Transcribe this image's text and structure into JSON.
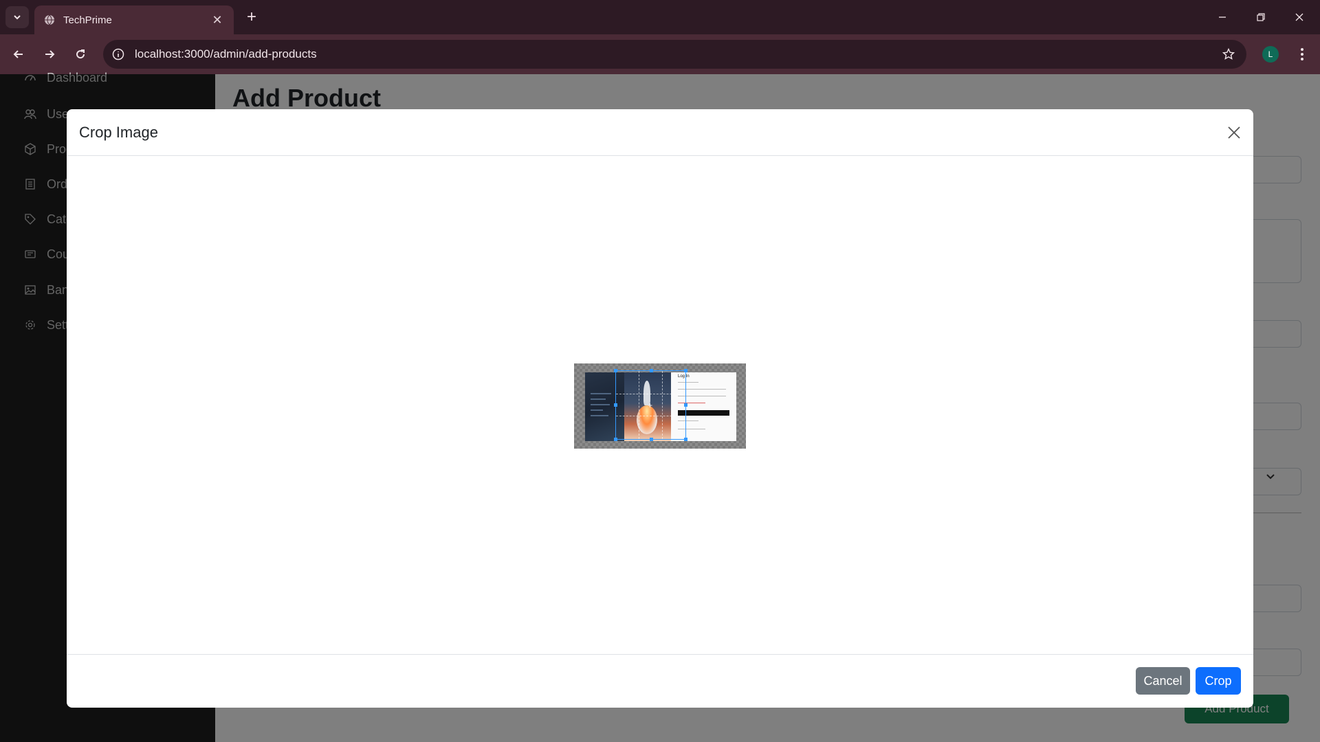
{
  "browser": {
    "tab_title": "TechPrime",
    "url": "localhost:3000/admin/add-products",
    "profile_initial": "L"
  },
  "sidebar": {
    "items": [
      {
        "label": "Dashboard",
        "icon": "dashboard-icon"
      },
      {
        "label": "Users",
        "icon": "users-icon"
      },
      {
        "label": "Products",
        "icon": "box-icon"
      },
      {
        "label": "Orders",
        "icon": "orders-icon"
      },
      {
        "label": "Categories",
        "icon": "tag-icon"
      },
      {
        "label": "Coupons",
        "icon": "coupon-icon"
      },
      {
        "label": "Banners",
        "icon": "image-icon"
      },
      {
        "label": "Settings",
        "icon": "gear-icon"
      }
    ]
  },
  "main": {
    "page_title": "Add Product",
    "submit_label": "Add Product"
  },
  "modal": {
    "title": "Crop Image",
    "cancel_label": "Cancel",
    "crop_label": "Crop",
    "preview_text": "Log In"
  },
  "colors": {
    "tab_bg": "#4a2a36",
    "titlebar_bg": "#2d1a24",
    "primary": "#0d6efd",
    "secondary": "#6c757d",
    "success": "#198754",
    "crop_guide": "#3399ff"
  }
}
